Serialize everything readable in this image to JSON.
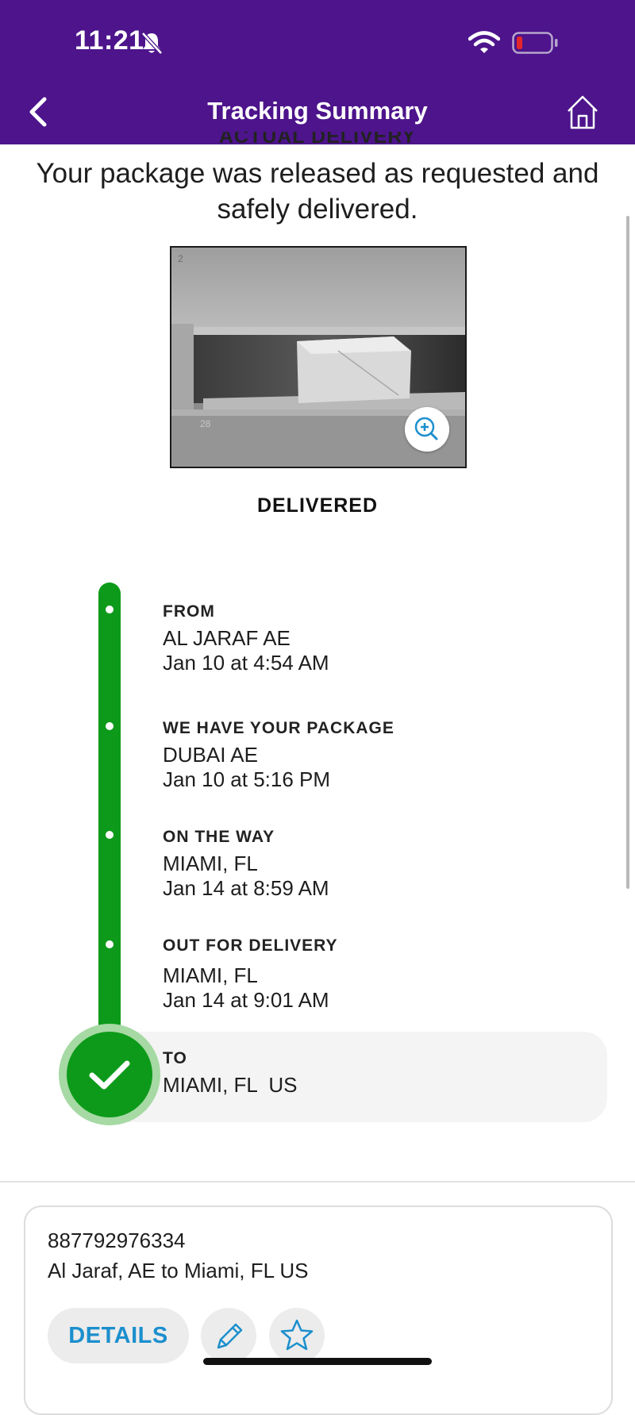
{
  "status_bar": {
    "time": "11:21"
  },
  "header": {
    "title": "Tracking Summary"
  },
  "partial_heading": "ACTUAL DELIVERY",
  "message": "Your package was released as requested and safely delivered.",
  "photo": {
    "locker_labels": [
      "2",
      "28"
    ]
  },
  "status_label": "DELIVERED",
  "timeline": {
    "events": [
      {
        "title": "FROM",
        "location": "AL JARAF AE",
        "time": "Jan 10 at 4:54 AM"
      },
      {
        "title": "WE HAVE YOUR PACKAGE",
        "location": "DUBAI AE",
        "time": "Jan 10 at 5:16 PM"
      },
      {
        "title": "ON THE WAY",
        "location": "MIAMI, FL",
        "time": "Jan 14 at 8:59 AM"
      },
      {
        "title": "OUT FOR DELIVERY",
        "location": "MIAMI, FL",
        "time": "Jan 14 at 9:01 AM"
      },
      {
        "title": "TO",
        "location": "MIAMI, FL  US"
      }
    ]
  },
  "shipment_card": {
    "tracking_number": "887792976334",
    "route": "Al Jaraf, AE to Miami, FL US",
    "details_label": "DETAILS"
  },
  "icons": {
    "bell": "bell-slash-icon",
    "wifi": "wifi-icon",
    "battery": "battery-low-icon",
    "back": "chevron-left-icon",
    "home": "home-icon",
    "zoom": "zoom-in-icon",
    "check": "check-icon",
    "edit": "pencil-icon",
    "favorite": "star-icon"
  },
  "colors": {
    "header": "#4d148c",
    "timeline": "#0d9a1a",
    "link": "#1c8fcd",
    "battery_low": "#e5262a"
  }
}
